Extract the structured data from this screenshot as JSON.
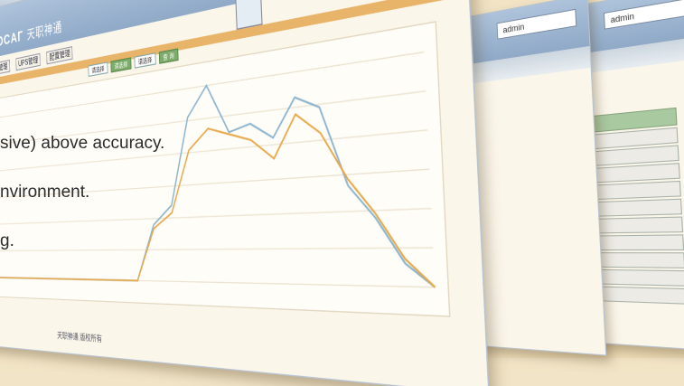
{
  "app": {
    "logo_text": "OCAГ",
    "logo_cn": "天职神通",
    "username": "admin"
  },
  "nav": {
    "items": [
      "机房管理",
      "UPS管理",
      "配置管理"
    ]
  },
  "filters": {
    "items": [
      "请选择",
      "请选择",
      "请选择",
      "查 询"
    ]
  },
  "footer": {
    "text": "天职神通 版权所有"
  },
  "captions": [
    "sive) above accuracy.",
    "nvironment.",
    "g."
  ],
  "chart_data": {
    "type": "line",
    "series": [
      {
        "values": [
          0,
          0,
          0,
          0,
          0,
          0,
          0,
          0,
          0,
          0,
          0,
          30,
          40,
          85,
          100,
          75,
          78,
          70,
          88,
          82,
          45,
          30,
          10,
          0
        ]
      },
      {
        "values": [
          0,
          0,
          0,
          0,
          0,
          0,
          0,
          0,
          0,
          0,
          0,
          28,
          36,
          68,
          78,
          74,
          70,
          60,
          80,
          70,
          48,
          32,
          12,
          0
        ]
      }
    ],
    "colors": [
      "#8cb5cf",
      "#e7a94c"
    ]
  }
}
